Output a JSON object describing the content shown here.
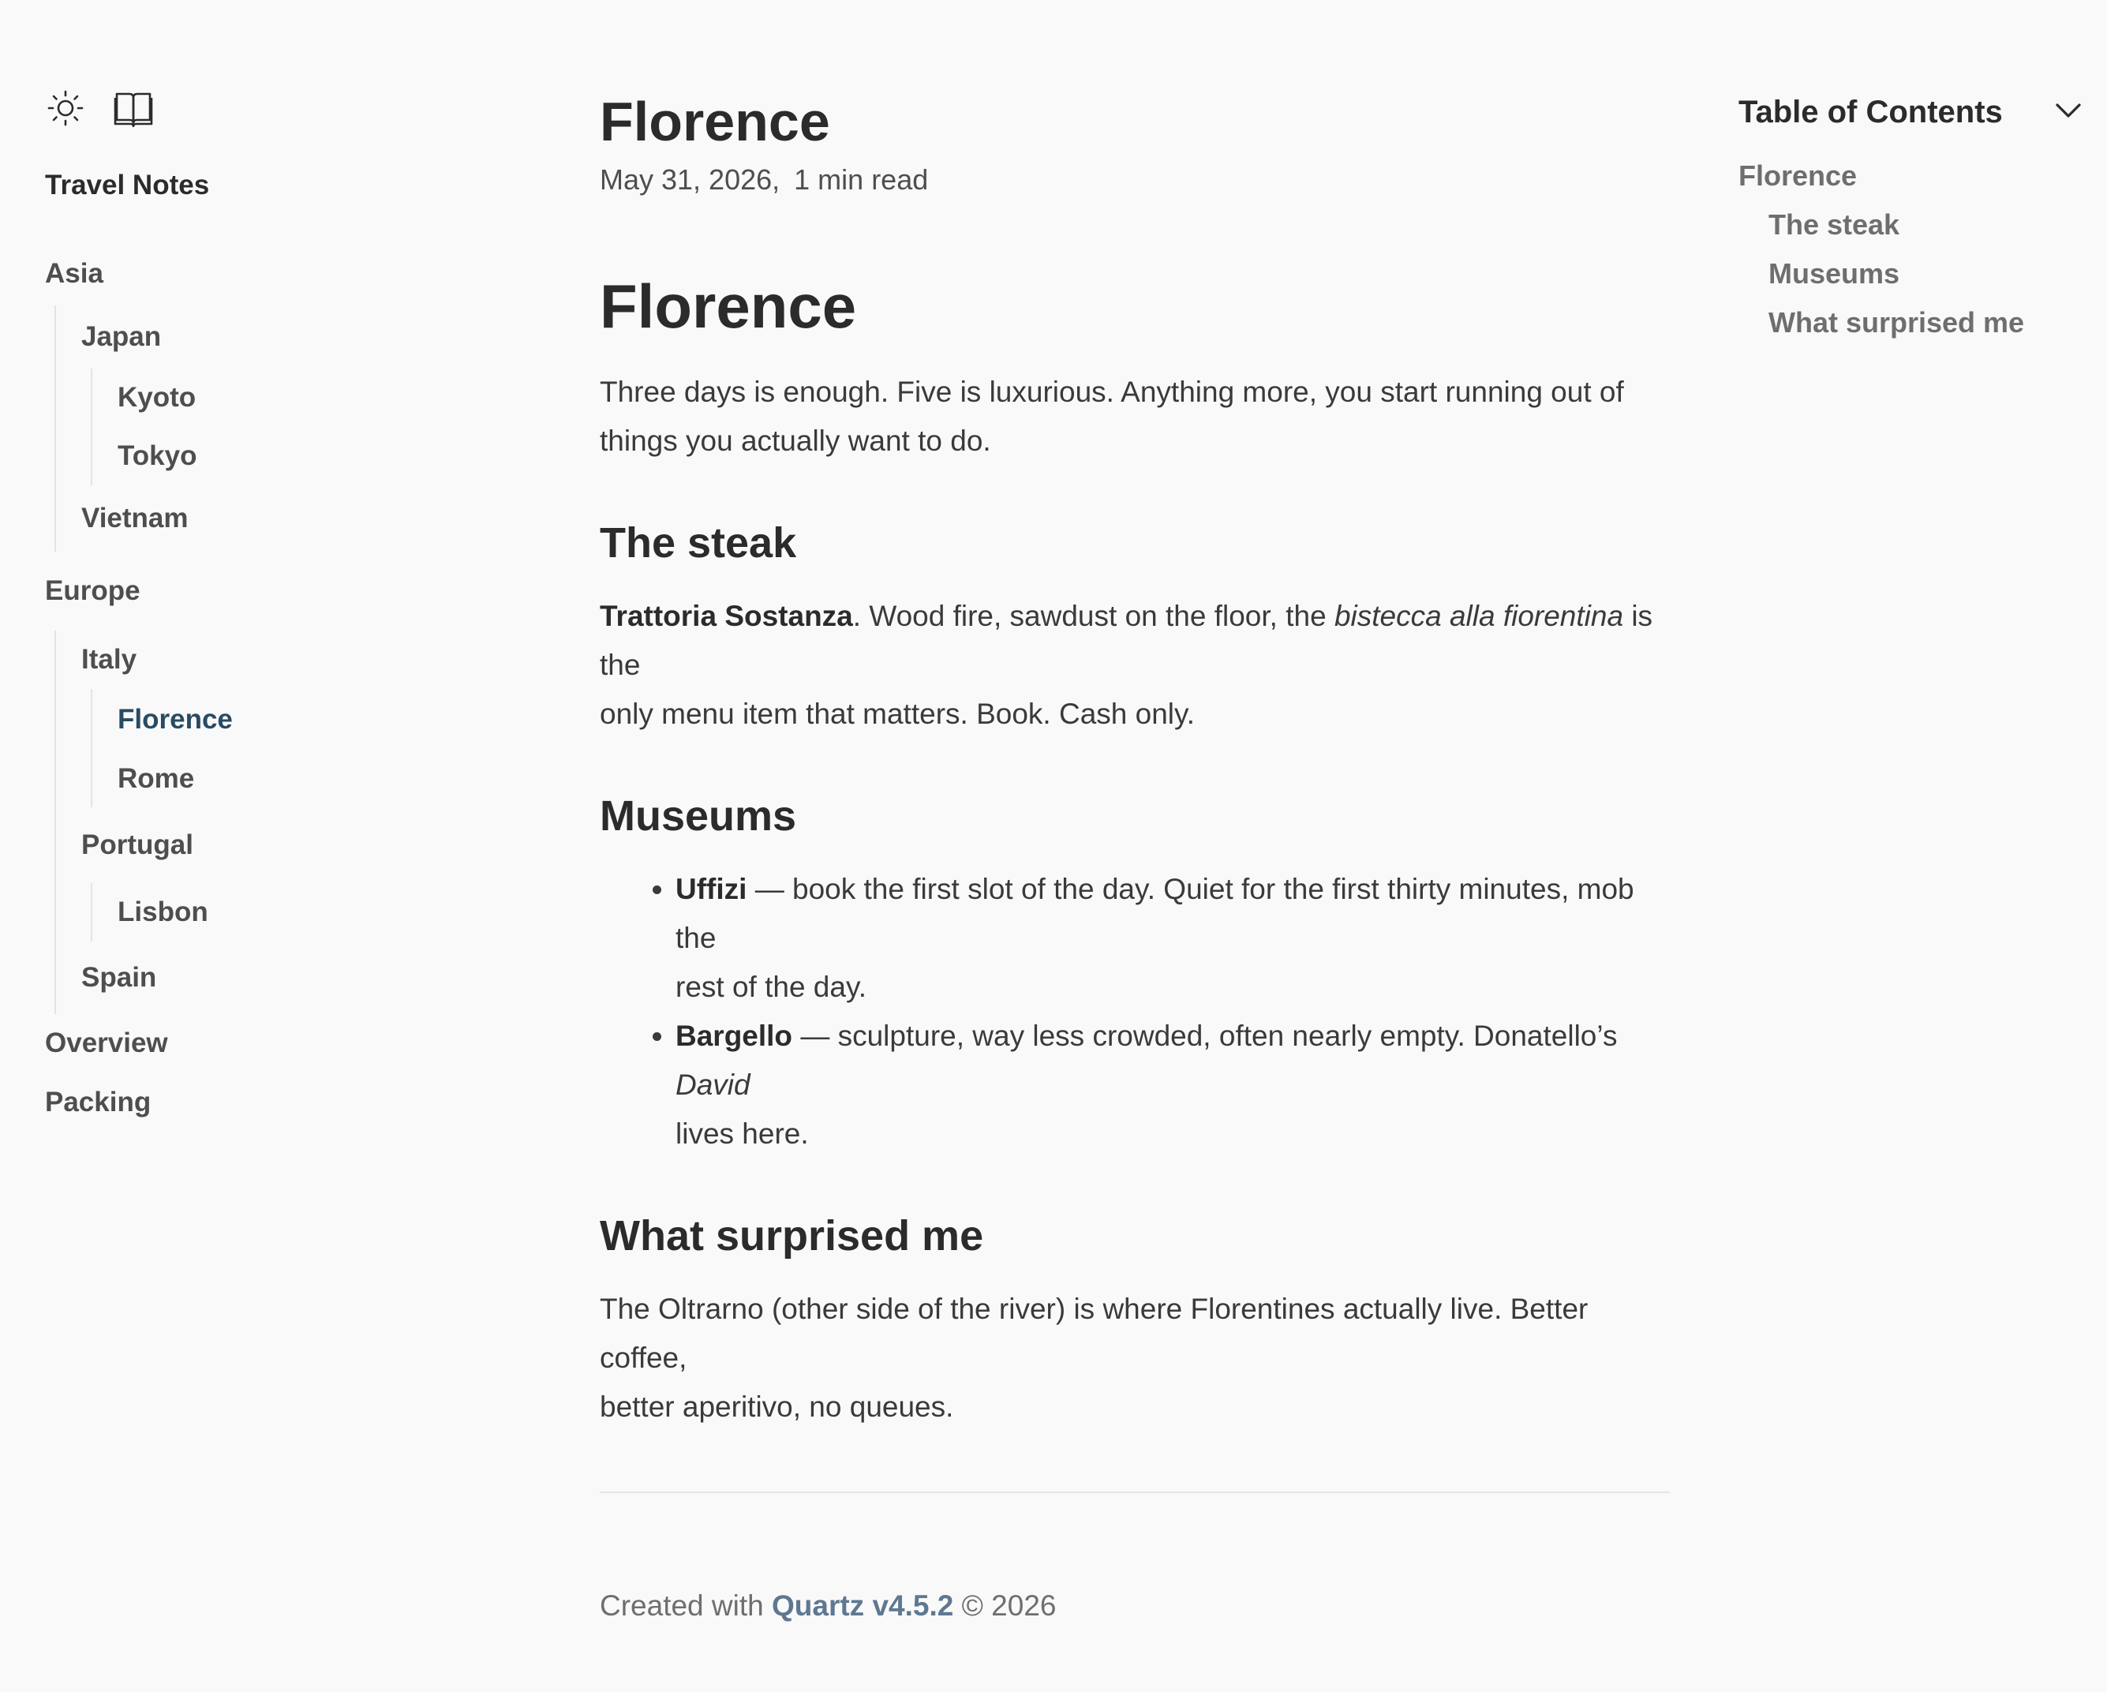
{
  "sidebar": {
    "icons": [
      "sun-icon",
      "book-icon"
    ],
    "site_title": "Travel Notes",
    "explorer": {
      "asia": "Asia",
      "japan": "Japan",
      "kyoto": "Kyoto",
      "tokyo": "Tokyo",
      "vietnam": "Vietnam",
      "europe": "Europe",
      "italy": "Italy",
      "florence": "Florence",
      "rome": "Rome",
      "portugal": "Portugal",
      "lisbon": "Lisbon",
      "spain": "Spain",
      "overview": "Overview",
      "packing": "Packing"
    },
    "active_item": "Florence"
  },
  "main": {
    "title": "Florence",
    "date": "May 31, 2026,",
    "read_time": "1 min read",
    "h1": "Florence",
    "intro_line1": "Three days is enough. Five is luxurious. Anything more, you start running out of",
    "intro_line2": "things you actually want to do.",
    "steak": {
      "heading": "The steak",
      "bold": "Trattoria Sostanza",
      "line1_a": ". Wood fire, sawdust on the floor, the ",
      "italic": "bistecca alla fiorentina",
      "line1_b": " is the",
      "line2": "only menu item that matters. Book. Cash only."
    },
    "museums": {
      "heading": "Museums",
      "uffizi_bold": "Uffizi",
      "uffizi_line1": " — book the first slot of the day. Quiet for the first thirty minutes, mob the",
      "uffizi_line2": "rest of the day.",
      "bargello_bold": "Bargello",
      "bargello_line1": " — sculpture, way less crowded, often nearly empty. Donatello’s ",
      "bargello_italic": "David",
      "bargello_line2": "lives here."
    },
    "surprised": {
      "heading": "What surprised me",
      "line1": "The Oltrarno (other side of the river) is where Florentines actually live. Better coffee,",
      "line2": "better aperitivo, no queues."
    }
  },
  "footer": {
    "prefix": "Created with ",
    "link": "Quartz v4.5.2",
    "suffix": " © 2026"
  },
  "toc": {
    "title": "Table of Contents",
    "items": [
      "Florence",
      "The steak",
      "Museums",
      "What surprised me"
    ]
  },
  "colors": {
    "background": "#faf9fa",
    "text": "#2b2b2b",
    "active": "#284b63",
    "footer_link": "#5f7891"
  }
}
